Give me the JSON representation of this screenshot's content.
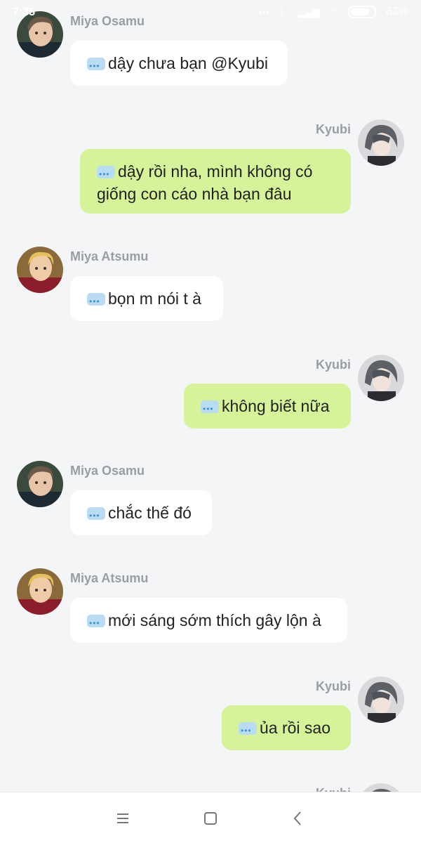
{
  "status_bar": {
    "time": "7:35",
    "battery": "83%"
  },
  "messages": [
    {
      "side": "left",
      "sender": "Miya Osamu",
      "text": "dậy chưa bạn @Kyubi",
      "avatar": "osamu"
    },
    {
      "side": "right",
      "sender": "Kyubi",
      "text": "dậy rồi nha, mình không có giống con cáo nhà bạn đâu",
      "avatar": "kyubi"
    },
    {
      "side": "left",
      "sender": "Miya Atsumu",
      "text": "bọn m nói t à",
      "avatar": "atsumu"
    },
    {
      "side": "right",
      "sender": "Kyubi",
      "text": "không biết nữa",
      "avatar": "kyubi"
    },
    {
      "side": "left",
      "sender": "Miya Osamu",
      "text": "chắc thế đó",
      "avatar": "osamu"
    },
    {
      "side": "left",
      "sender": "Miya Atsumu",
      "text": "mới sáng sớm thích gây lộn à",
      "avatar": "atsumu"
    },
    {
      "side": "right",
      "sender": "Kyubi",
      "text": "ủa rồi sao",
      "avatar": "kyubi"
    },
    {
      "side": "right",
      "sender": "Kyubi",
      "text": "",
      "avatar": "kyubi"
    }
  ],
  "colors": {
    "background": "#f4f5f7",
    "bubble_left": "#ffffff",
    "bubble_right": "#d6f39a",
    "name_text": "#9a9da4"
  },
  "nav": {
    "menu_icon": "menu-icon",
    "home_icon": "square-home-icon",
    "back_icon": "chevron-left-icon"
  }
}
